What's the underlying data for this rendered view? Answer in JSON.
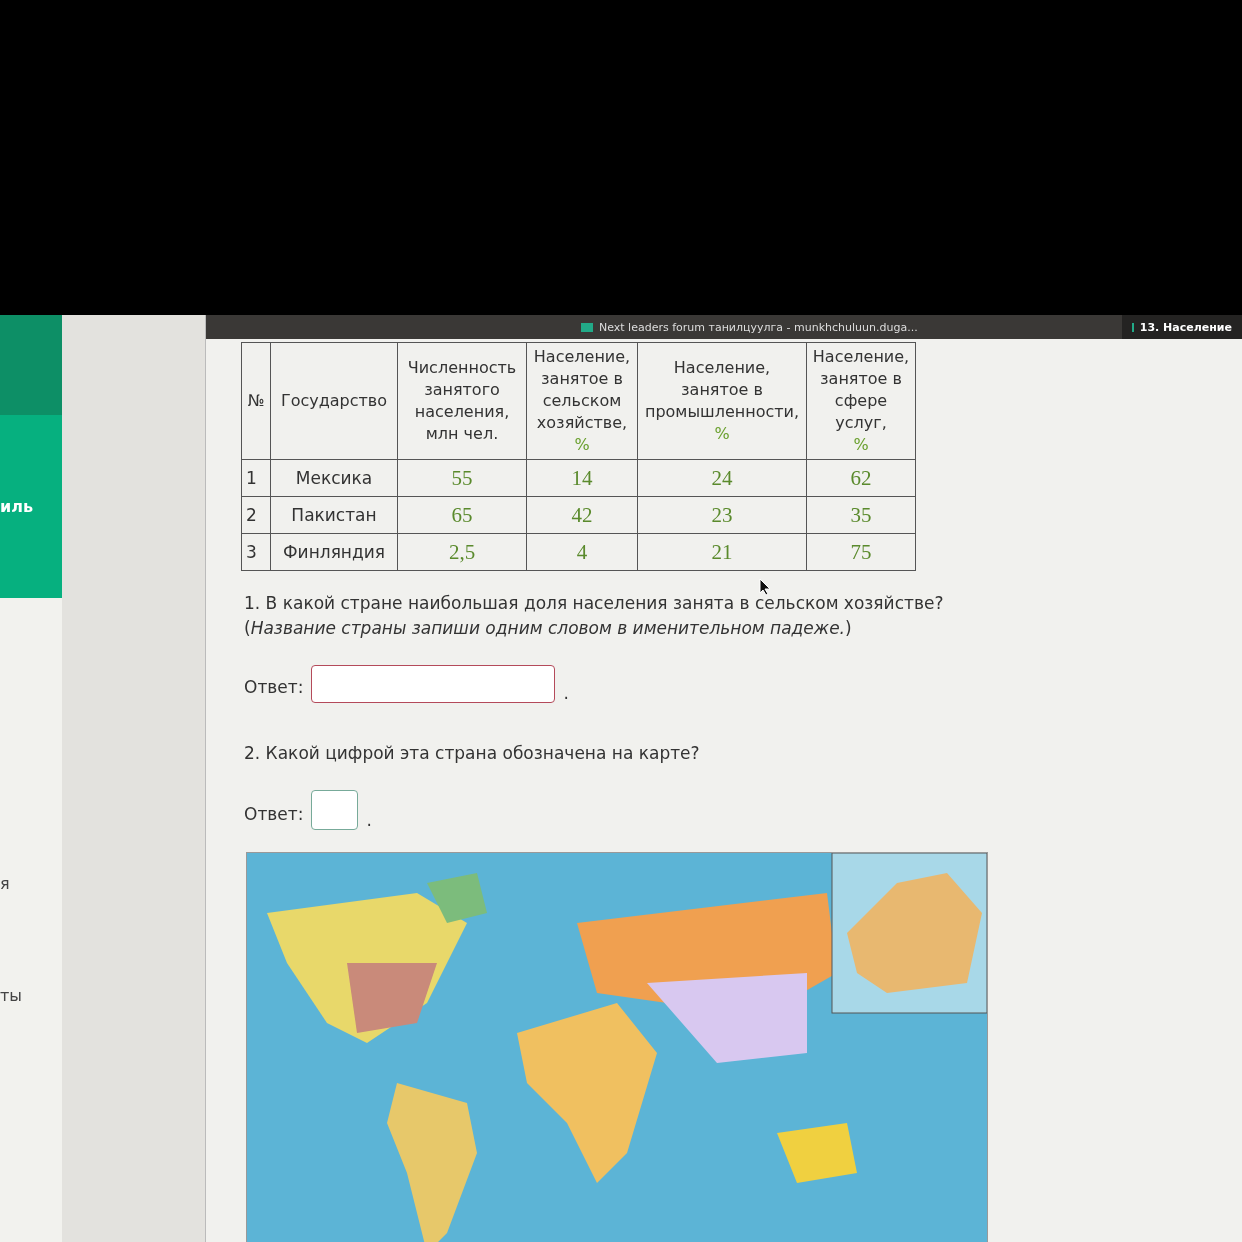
{
  "browser_tabs": [
    {
      "title": "Next leaders forum танилцуулга - munkhchuluun.duga...",
      "selected": false
    },
    {
      "title": "13. Население",
      "selected": true
    }
  ],
  "sidebar": {
    "items": [
      {
        "label": "иль",
        "selected": true
      },
      {
        "label": "я",
        "selected": false
      },
      {
        "label": "ты",
        "selected": false
      }
    ]
  },
  "table": {
    "columns": [
      {
        "text": "№"
      },
      {
        "text": "Государство"
      },
      {
        "text": "Численность занятого населения, млн чел."
      },
      {
        "text": "Население, занятое в сельском хозяйстве,",
        "unit": "%"
      },
      {
        "text": "Население, занятое в промышленности,",
        "unit": "%"
      },
      {
        "text": "Население, занятое в сфере услуг,",
        "unit": "%"
      }
    ],
    "rows": [
      [
        "1",
        "Мексика",
        "55",
        "14",
        "24",
        "62"
      ],
      [
        "2",
        "Пакистан",
        "65",
        "42",
        "23",
        "35"
      ],
      [
        "3",
        "Финляндия",
        "2,5",
        "4",
        "21",
        "75"
      ]
    ]
  },
  "questions": [
    {
      "text": "1. В какой стране наибольшая доля населения занята в сельском хозяйстве?",
      "hint": "(*Название страны запиши одним словом в именительном падеже.*)",
      "answer_label": "Ответ:",
      "kind": "wide",
      "after": "."
    },
    {
      "text": "2. Какой цифрой эта страна обозначена на карте?",
      "answer_label": "Ответ:",
      "kind": "short",
      "after": "."
    }
  ]
}
